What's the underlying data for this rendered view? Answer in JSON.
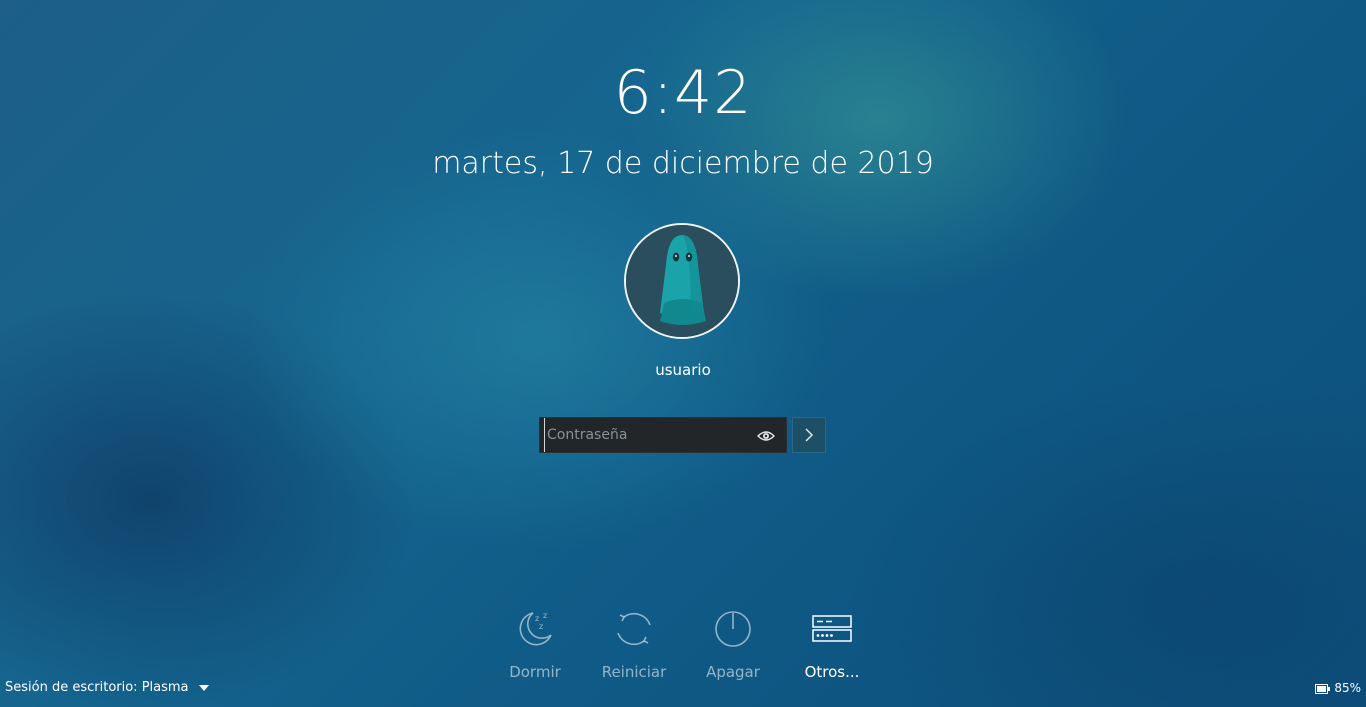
{
  "lock_screen": {
    "time": "6:42",
    "date": "martes, 17 de diciembre de 2019",
    "user": {
      "name": "usuario",
      "avatar_icon": "ghost-avatar"
    },
    "password": {
      "value": "",
      "placeholder": "Contraseña",
      "reveal_icon": "eye-icon",
      "submit_icon": "chevron-right-icon"
    },
    "actions": [
      {
        "label": "Dormir",
        "icon": "sleep-moon-icon"
      },
      {
        "label": "Reiniciar",
        "icon": "restart-icon"
      },
      {
        "label": "Apagar",
        "icon": "power-icon"
      },
      {
        "label": "Otros...",
        "icon": "other-sessions-icon"
      }
    ],
    "session": {
      "label": "Sesión de escritorio: Plasma"
    },
    "battery": {
      "percent": "85%",
      "icon": "battery-icon"
    }
  },
  "colors": {
    "background_main": "#15658f",
    "field_bg": "#232629",
    "button_bg": "#1d4f66"
  }
}
